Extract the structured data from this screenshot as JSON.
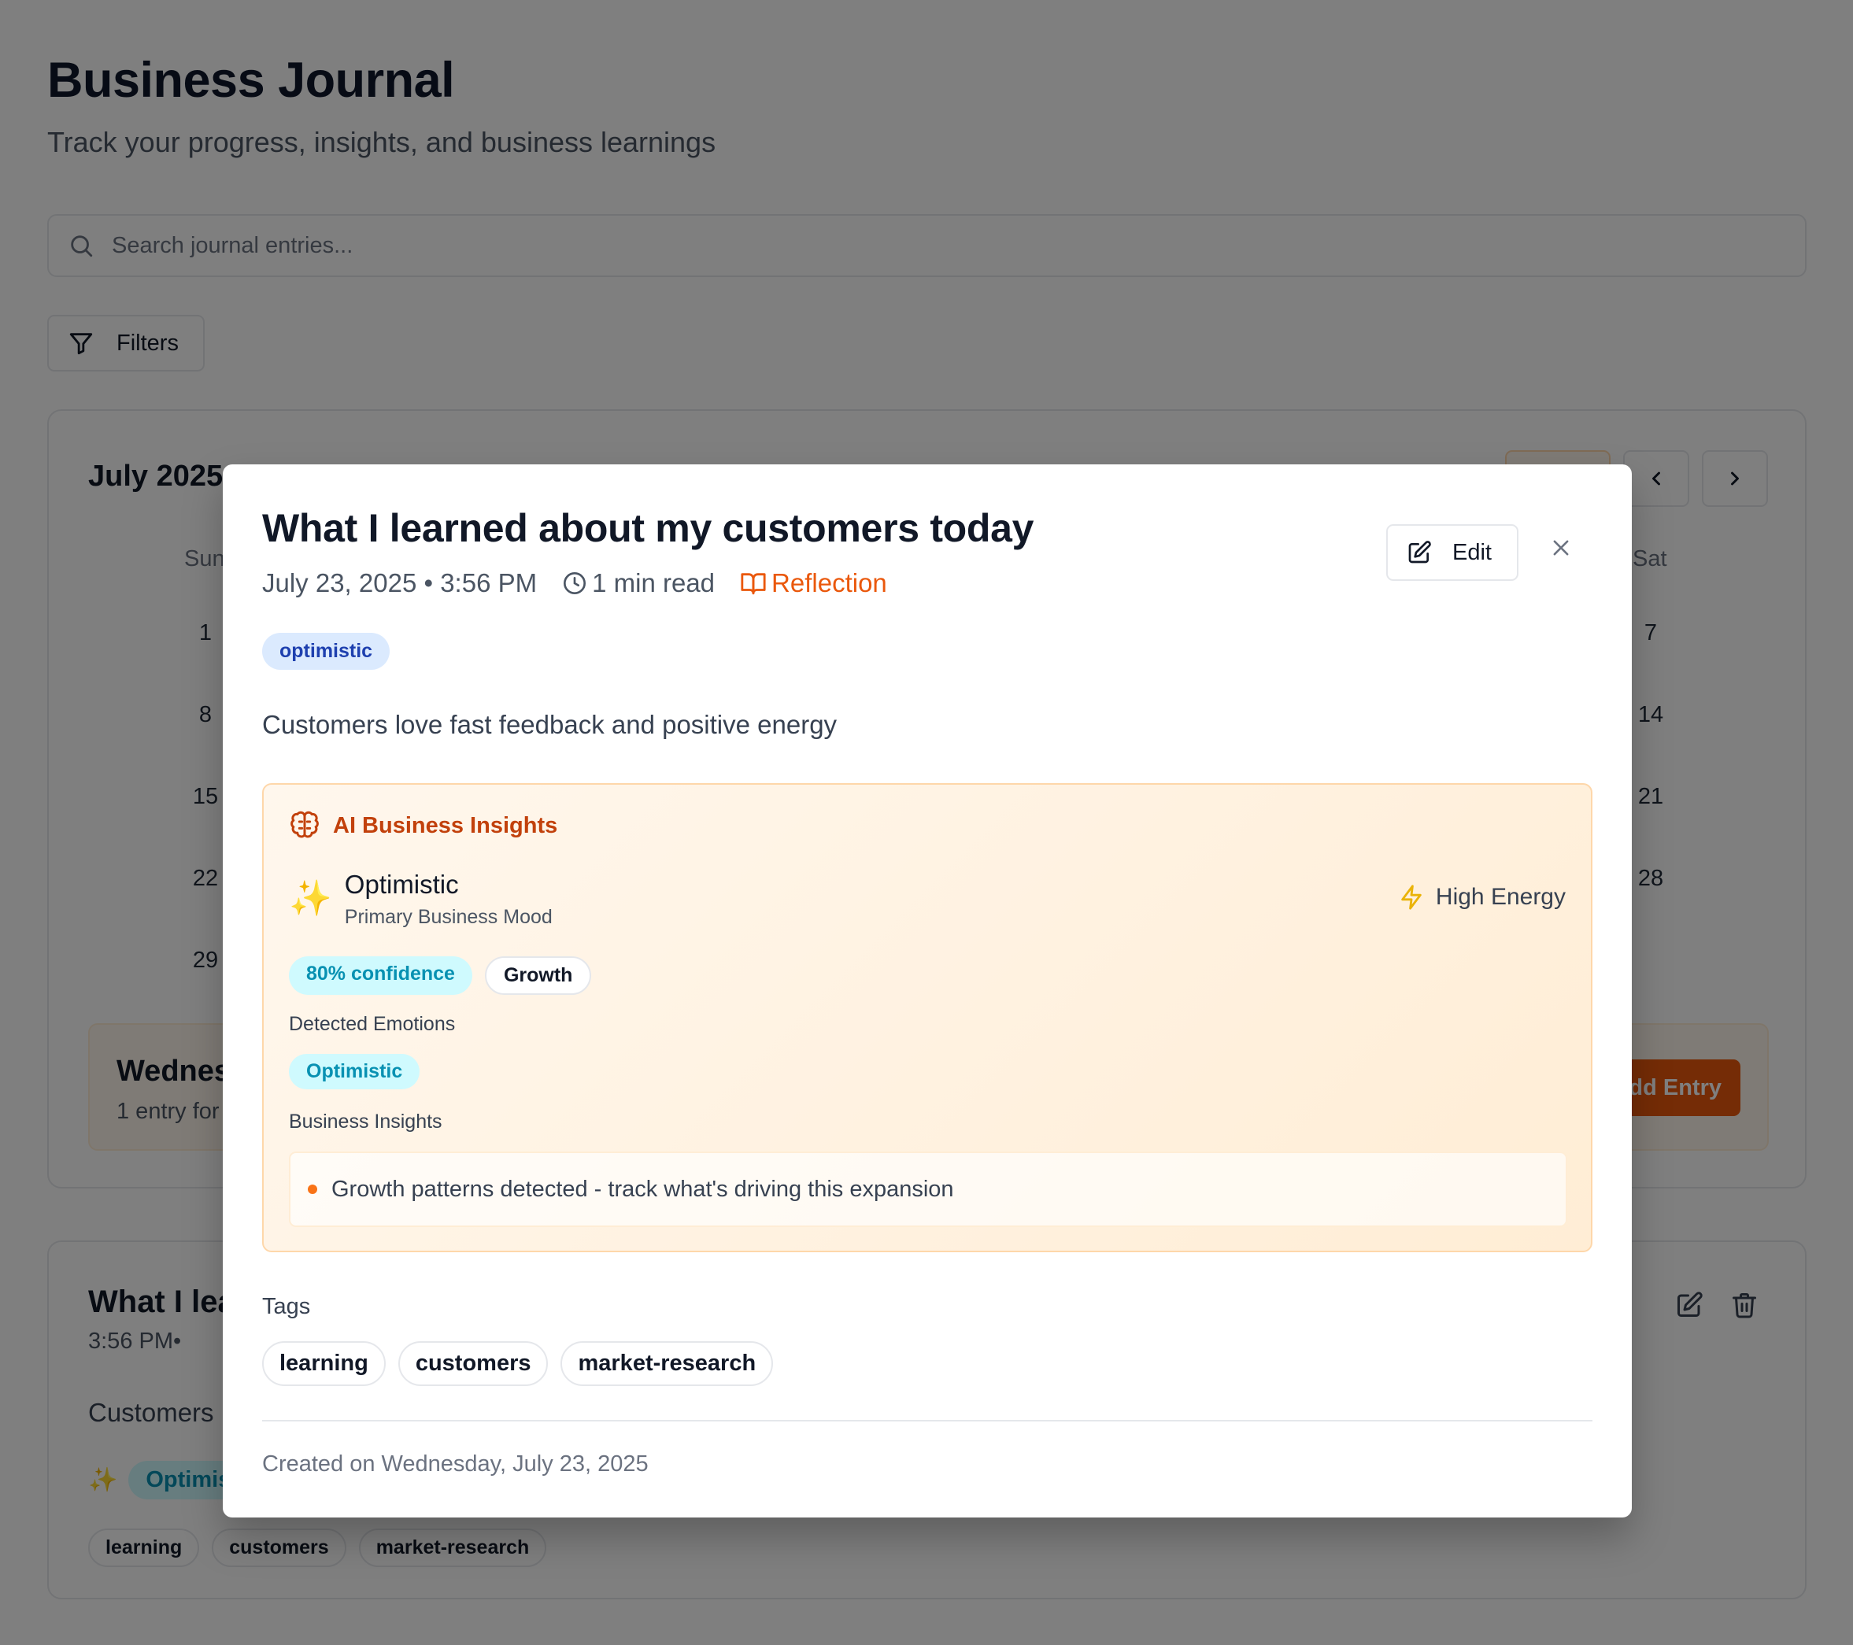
{
  "header": {
    "title": "Business Journal",
    "subtitle": "Track your progress, insights, and business learnings"
  },
  "search": {
    "placeholder": "Search journal entries..."
  },
  "filters": {
    "label": "Filters"
  },
  "calendar": {
    "month_label": "July 2025",
    "weekdays": [
      "Sun",
      "Sat"
    ],
    "visible_days_left": [
      "1",
      "8",
      "15",
      "22",
      "29"
    ],
    "visible_days_right": [
      "7",
      "14",
      "21",
      "28"
    ],
    "selected_day": {
      "title": "Wednes",
      "subtitle": "1 entry for",
      "add_button": "dd Entry"
    }
  },
  "entry_card": {
    "title": "What I lea",
    "meta": "3:56 PM•",
    "body": "Customers",
    "mood": "Optimist",
    "tags": [
      "learning",
      "customers",
      "market-research"
    ]
  },
  "modal": {
    "title": "What I learned about my customers today",
    "date": "July 23, 2025 • 3:56 PM",
    "read_time": "1 min read",
    "category": "Reflection",
    "edit_label": "Edit",
    "mood_badge": "optimistic",
    "body": "Customers love fast feedback and positive energy",
    "ai": {
      "heading": "AI Business Insights",
      "mood_name": "Optimistic",
      "mood_caption": "Primary Business Mood",
      "energy": "High Energy",
      "confidence": "80% confidence",
      "category": "Growth",
      "emotions_label": "Detected Emotions",
      "emotions": [
        "Optimistic"
      ],
      "insights_label": "Business Insights",
      "insights": [
        "Growth patterns detected - track what's driving this expansion"
      ]
    },
    "tags_label": "Tags",
    "tags": [
      "learning",
      "customers",
      "market-research"
    ],
    "created": "Created on Wednesday, July 23, 2025"
  },
  "colors": {
    "accent": "#ea580c",
    "ai_heading": "#c2410c",
    "confidence": "#0891b2",
    "mood_badge_bg": "#dbeafe",
    "overlay": "rgba(0,0,0,0.5)"
  },
  "icons": {
    "search": "search-icon",
    "filter": "filter-icon",
    "clock": "clock-icon",
    "book": "book-open-icon",
    "edit": "edit-icon",
    "close": "close-icon",
    "brain": "brain-icon",
    "sparkles": "sparkles-icon",
    "zap": "zap-icon",
    "trash": "trash-icon",
    "chevron_left": "chevron-left-icon",
    "chevron_right": "chevron-right-icon"
  }
}
